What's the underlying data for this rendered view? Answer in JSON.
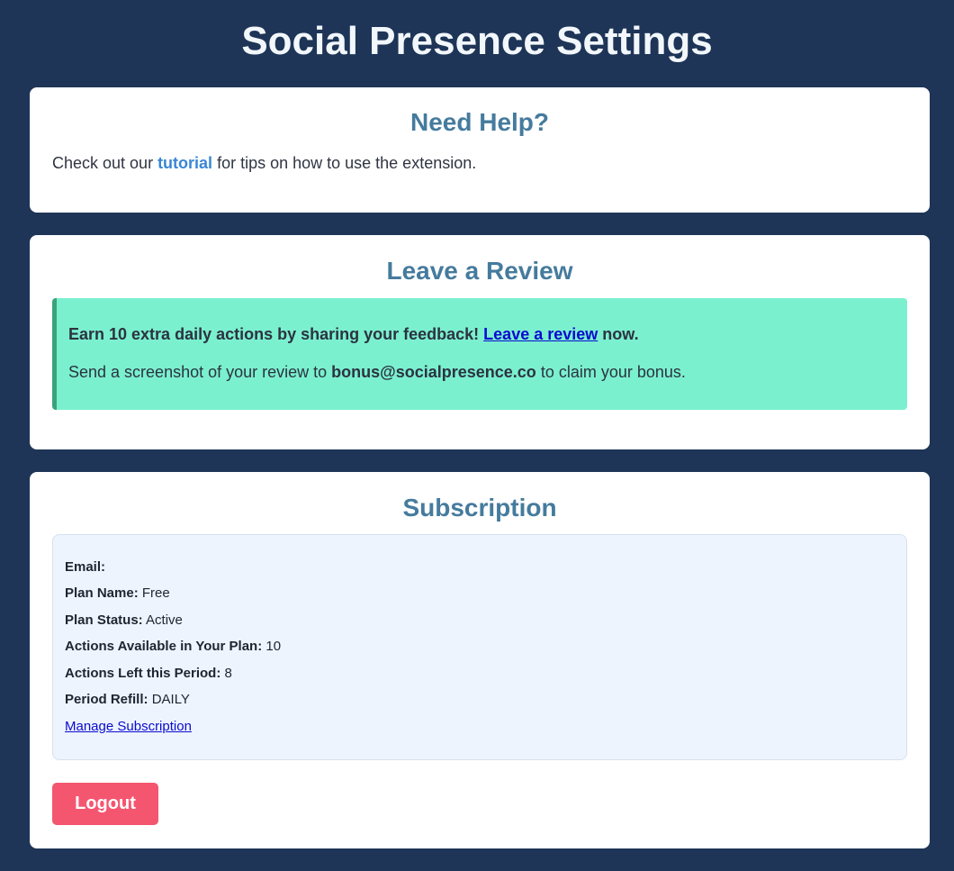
{
  "page": {
    "title": "Social Presence Settings"
  },
  "help": {
    "title": "Need Help?",
    "text_before": "Check out our ",
    "link_text": "tutorial",
    "text_after": " for tips on how to use the extension."
  },
  "review": {
    "title": "Leave a Review",
    "line1_before": "Earn 10 extra daily actions by sharing your feedback! ",
    "line1_link": "Leave a review",
    "line1_after": " now.",
    "line2_before": "Send a screenshot of your review to ",
    "line2_email": "bonus@socialpresence.co",
    "line2_after": " to claim your bonus."
  },
  "subscription": {
    "title": "Subscription",
    "rows": [
      {
        "label": "Email:",
        "value": ""
      },
      {
        "label": "Plan Name:",
        "value": "Free"
      },
      {
        "label": "Plan Status:",
        "value": "Active"
      },
      {
        "label": "Actions Available in Your Plan:",
        "value": "10"
      },
      {
        "label": "Actions Left this Period:",
        "value": "8"
      },
      {
        "label": "Period Refill:",
        "value": "DAILY"
      }
    ],
    "manage_link": "Manage Subscription",
    "logout_label": "Logout"
  },
  "colors": {
    "background": "#1e3557",
    "card_title": "#457b9d",
    "review_box": "#7bf0cf",
    "logout_button": "#f45670"
  }
}
